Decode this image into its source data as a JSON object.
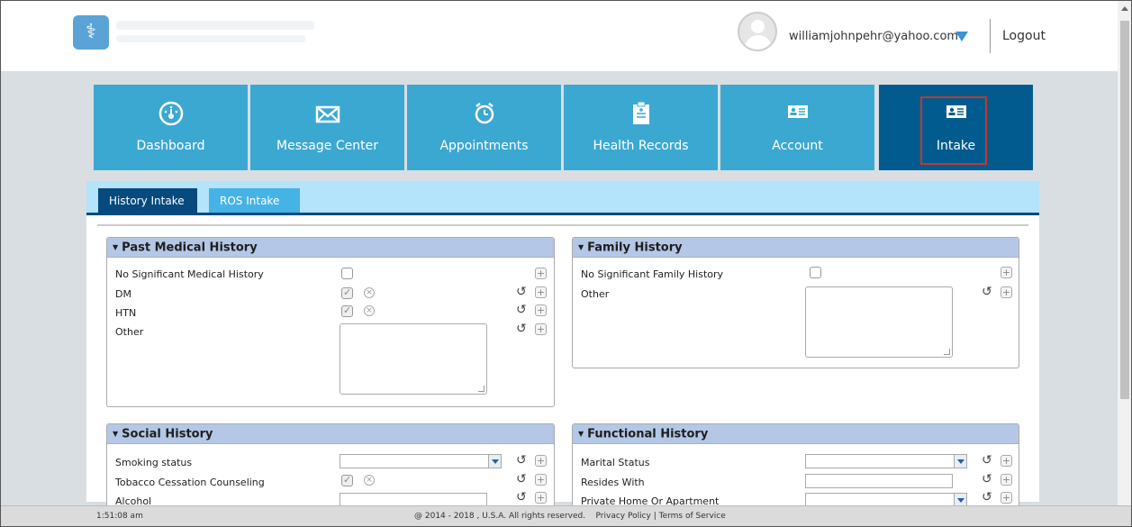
{
  "header": {
    "user_email": "williamjohnpehr@yahoo.com",
    "logout": "Logout"
  },
  "nav": [
    {
      "label": "Dashboard",
      "icon": "dashboard-icon"
    },
    {
      "label": "Message Center",
      "icon": "envelope-icon"
    },
    {
      "label": "Appointments",
      "icon": "alarm-clock-icon"
    },
    {
      "label": "Health Records",
      "icon": "clipboard-icon"
    },
    {
      "label": "Account",
      "icon": "id-card-icon"
    },
    {
      "label": "Intake",
      "icon": "id-card-icon",
      "active": true
    }
  ],
  "tabs": [
    {
      "label": "History Intake",
      "active": true
    },
    {
      "label": "ROS Intake",
      "active": false
    }
  ],
  "past_medical": {
    "title": "Past Medical History",
    "rows": [
      {
        "label": "No Significant Medical History",
        "checked": false
      },
      {
        "label": "DM",
        "checked": true
      },
      {
        "label": "HTN",
        "checked": true
      },
      {
        "label": "Other"
      }
    ]
  },
  "family": {
    "title": "Family History",
    "rows": [
      {
        "label": "No Significant Family History",
        "checked": false
      },
      {
        "label": "Other"
      }
    ]
  },
  "social": {
    "title": "Social History",
    "rows": [
      {
        "label": "Smoking status",
        "value": ""
      },
      {
        "label": "Tobacco Cessation Counseling",
        "checked": true
      },
      {
        "label": "Alcohol",
        "value": ""
      }
    ]
  },
  "functional": {
    "title": "Functional History",
    "rows": [
      {
        "label": "Marital Status",
        "value": ""
      },
      {
        "label": "Resides With",
        "value": ""
      },
      {
        "label": "Private Home Or Apartment",
        "value": ""
      }
    ]
  },
  "footer": {
    "time": "1:51:08 am",
    "copyright": "@ 2014 - 2018 , U.S.A. All rights reserved.    Privacy Policy | Terms of Service"
  },
  "colors": {
    "tile": "#3ba8d2",
    "tile_active": "#015b8e",
    "tab_active": "#064a7e",
    "tab_inactive": "#46b3e6",
    "section_header": "#b5c7e6"
  }
}
